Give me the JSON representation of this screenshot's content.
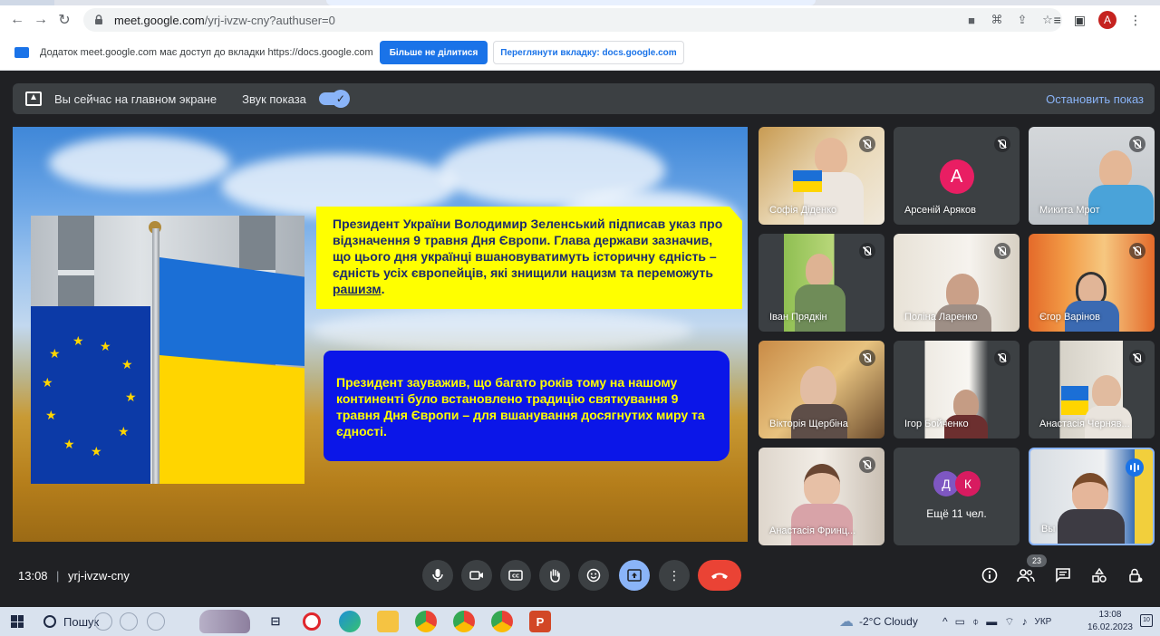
{
  "browser": {
    "url_host": "meet.google.com",
    "url_path": "/yrj-ivzw-cny?authuser=0",
    "profile_initial": "A"
  },
  "share_notice": {
    "text": "Додаток meet.google.com має доступ до вкладки https://docs.google.com",
    "stop_sharing_label": "Більше не ділитися",
    "view_tab_label": "Переглянути вкладку: docs.google.com"
  },
  "presenting_bar": {
    "status": "Вы сейчас на главном экране",
    "sound_label": "Звук показа",
    "stop_label": "Остановить показ"
  },
  "slide": {
    "yellow_text": "Президент України Володимир Зеленський підписав указ про відзначення 9 травня Дня Європи. Глава держави зазначив, що цього дня українці вшановуватимуть історичну єдність – єдність усіх європейців, які знищили нацизм та переможуть",
    "yellow_text_end": "рашизм",
    "yellow_text_dot": ".",
    "blue_text": "Президент зауважив, що багато років тому на нашому континенті було встановлено традицію святкування 9 травня Дня Європи – для вшанування досягнутих миру та єдності."
  },
  "participants": [
    {
      "name": "Софія Діденко"
    },
    {
      "name": "Арсеній Аряков",
      "initial": "А"
    },
    {
      "name": "Микита Мрот"
    },
    {
      "name": "Іван Прядкін"
    },
    {
      "name": "Поліна Ларенко"
    },
    {
      "name": "Єгор Варінов"
    },
    {
      "name": "Вікторія Щербіна"
    },
    {
      "name": "Ігор Бойченко"
    },
    {
      "name": "Анастасія Черняв..."
    },
    {
      "name": "Анастасія Фринц..."
    },
    {
      "name": "Ещё 11 чел.",
      "initials": [
        "Д",
        "К"
      ]
    },
    {
      "name": "Вы"
    }
  ],
  "meeting": {
    "time": "13:08",
    "separator": "|",
    "code": "yrj-ivzw-cny",
    "people_count": "23"
  },
  "taskbar": {
    "search_label": "Пошук",
    "weather": "-2°C  Cloudy",
    "language": "УКР",
    "time": "13:08",
    "date": "16.02.2023",
    "notifications": "10"
  },
  "colors": {
    "meet_bg": "#202124",
    "accent": "#8ab4f8",
    "end_call": "#ea4335",
    "google_blue": "#1a73e8"
  }
}
